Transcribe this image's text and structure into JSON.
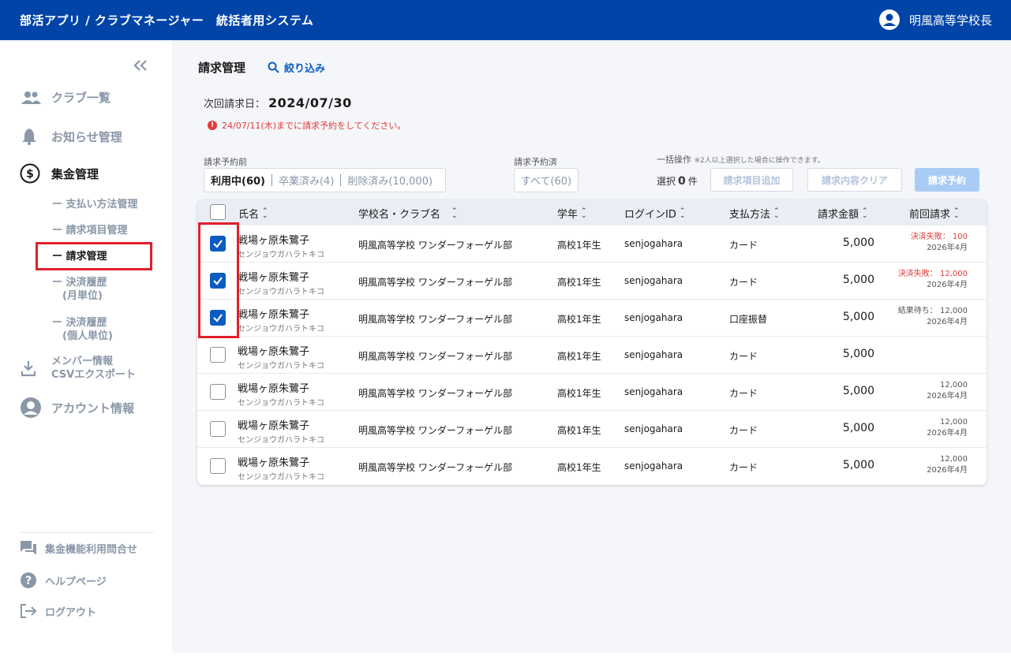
{
  "app": {
    "title": "部活アプリ / クラブマネージャー　統括者用システム",
    "user_name": "明風高等学校長"
  },
  "sidebar": {
    "items": [
      {
        "label": "クラブ一覧"
      },
      {
        "label": "お知らせ管理"
      },
      {
        "label": "集金管理"
      },
      {
        "label": "メンバー情報\nCSVエクスポート"
      },
      {
        "label": "アカウント情報"
      }
    ],
    "sub_items": [
      {
        "label": "ー 支払い方法管理"
      },
      {
        "label": "ー 請求項目管理"
      },
      {
        "label": "ー 請求管理"
      },
      {
        "label": "ー 決済履歴\n　(月単位)"
      },
      {
        "label": "ー 決済履歴\n　(個人単位)"
      }
    ],
    "bottom": [
      {
        "label": "集金機能利用問合せ"
      },
      {
        "label": "ヘルプページ"
      },
      {
        "label": "ログアウト"
      }
    ]
  },
  "page": {
    "title": "請求管理",
    "filter_label": "絞り込み",
    "next_billing_label": "次回請求日：",
    "next_billing_date": "2024/07/30",
    "warning": "24/07/11(木)までに請求予約をしてください。"
  },
  "filters": {
    "group1_label": "請求予約前",
    "group1_options": [
      "利用中(60)",
      "卒業済み(4)",
      "削除済み(10,000)"
    ],
    "group2_label": "請求予約済",
    "group2_option": "すべて(60)"
  },
  "bulk": {
    "title": "一括操作",
    "note": "※2人以上選択した場合に操作できます。",
    "selected_label_before": "選択",
    "selected_count": "0",
    "selected_label_after": "件",
    "add_item_button": "請求項目追加",
    "clear_button": "請求内容クリア",
    "reserve_button": "請求予約"
  },
  "table": {
    "headers": [
      "氏名",
      "学校名・クラブ名",
      "学年",
      "ログインID",
      "支払方法",
      "請求金額",
      "前回請求"
    ],
    "rows": [
      {
        "checked": true,
        "name": "戦場ヶ原朱鷺子",
        "kana": "センジョウガハラトキコ",
        "school": "明風高等学校 ワンダーフォーゲル部",
        "grade": "高校1年生",
        "login": "senjogahara",
        "method": "カード",
        "amount": "5,000",
        "prev_status": "決済失敗：",
        "prev_amount": "100",
        "prev_red": true,
        "prev_date": "2026年4月"
      },
      {
        "checked": true,
        "name": "戦場ヶ原朱鷺子",
        "kana": "センジョウガハラトキコ",
        "school": "明風高等学校 ワンダーフォーゲル部",
        "grade": "高校1年生",
        "login": "senjogahara",
        "method": "カード",
        "amount": "5,000",
        "prev_status": "決済失敗：",
        "prev_amount": "12,000",
        "prev_red": true,
        "prev_date": "2026年4月"
      },
      {
        "checked": true,
        "name": "戦場ヶ原朱鷺子",
        "kana": "センジョウガハラトキコ",
        "school": "明風高等学校 ワンダーフォーゲル部",
        "grade": "高校1年生",
        "login": "senjogahara",
        "method": "口座振替",
        "amount": "5,000",
        "prev_status": "結果待ち：",
        "prev_amount": "12,000",
        "prev_red": false,
        "prev_date": "2026年4月"
      },
      {
        "checked": false,
        "name": "戦場ヶ原朱鷺子",
        "kana": "センジョウガハラトキコ",
        "school": "明風高等学校 ワンダーフォーゲル部",
        "grade": "高校1年生",
        "login": "senjogahara",
        "method": "カード",
        "amount": "5,000",
        "prev_status": "",
        "prev_amount": "",
        "prev_red": false,
        "prev_date": ""
      },
      {
        "checked": false,
        "name": "戦場ヶ原朱鷺子",
        "kana": "センジョウガハラトキコ",
        "school": "明風高等学校 ワンダーフォーゲル部",
        "grade": "高校1年生",
        "login": "senjogahara",
        "method": "カード",
        "amount": "5,000",
        "prev_status": "",
        "prev_amount": "12,000",
        "prev_red": false,
        "prev_date": "2026年4月"
      },
      {
        "checked": false,
        "name": "戦場ヶ原朱鷺子",
        "kana": "センジョウガハラトキコ",
        "school": "明風高等学校 ワンダーフォーゲル部",
        "grade": "高校1年生",
        "login": "senjogahara",
        "method": "カード",
        "amount": "5,000",
        "prev_status": "",
        "prev_amount": "12,000",
        "prev_red": false,
        "prev_date": "2026年4月"
      },
      {
        "checked": false,
        "name": "戦場ヶ原朱鷺子",
        "kana": "センジョウガハラトキコ",
        "school": "明風高等学校 ワンダーフォーゲル部",
        "grade": "高校1年生",
        "login": "senjogahara",
        "method": "カード",
        "amount": "5,000",
        "prev_status": "",
        "prev_amount": "12,000",
        "prev_red": false,
        "prev_date": "2026年4月"
      }
    ]
  },
  "colors": {
    "brand": "#0044a8",
    "accent": "#0b5cc2",
    "error": "#e03a3a",
    "annotation": "#e0202a"
  }
}
